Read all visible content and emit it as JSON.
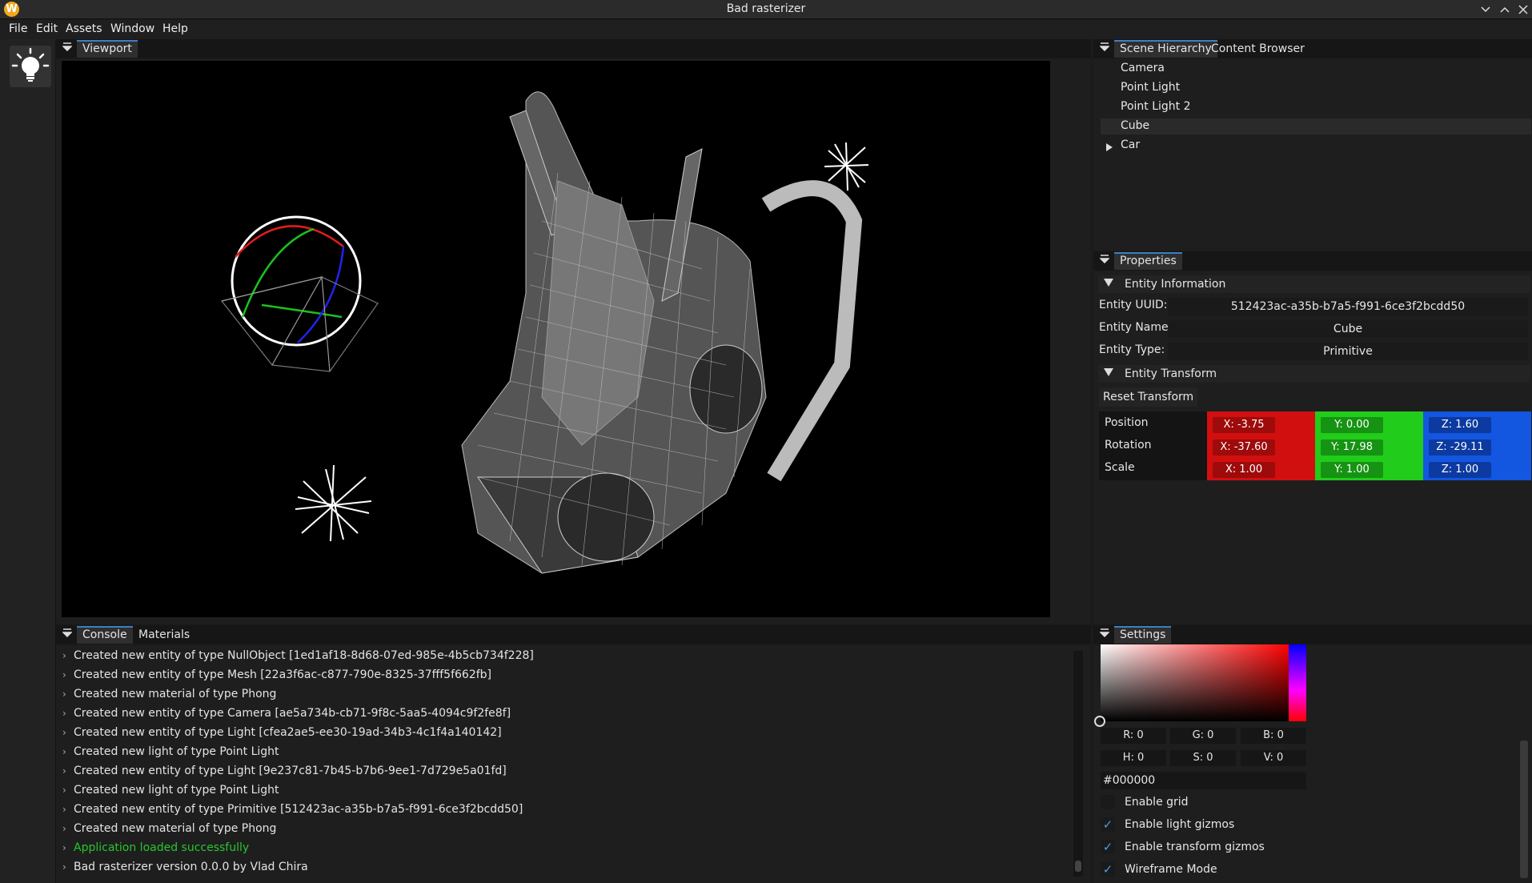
{
  "window": {
    "logo": "W",
    "title": "Bad rasterizer"
  },
  "menu": [
    "File",
    "Edit",
    "Assets",
    "Window",
    "Help"
  ],
  "viewport": {
    "tab": "Viewport"
  },
  "scene": {
    "tabs": [
      "Scene Hierarchy",
      "Content Browser"
    ],
    "items": [
      "Camera",
      "Point Light",
      "Point Light 2",
      "Cube",
      "Car"
    ],
    "selected": "Cube"
  },
  "properties": {
    "tab": "Properties",
    "entity_info": {
      "header": "Entity Information",
      "uuid_label": "Entity UUID:",
      "uuid": "512423ac-a35b-b7a5-f991-6ce3f2bcdd50",
      "name_label": "Entity Name:",
      "name": "Cube",
      "type_label": "Entity Type:",
      "type": "Primitive"
    },
    "transform": {
      "header": "Entity Transform",
      "reset": "Reset Transform",
      "rows": [
        {
          "label": "Position",
          "x": "X: -3.75",
          "y": "Y: 0.00",
          "z": "Z: 1.60"
        },
        {
          "label": "Rotation",
          "x": "X: -37.60",
          "y": "Y: 17.98",
          "z": "Z: -29.11"
        },
        {
          "label": "Scale",
          "x": "X: 1.00",
          "y": "Y: 1.00",
          "z": "Z: 1.00"
        }
      ],
      "colors": {
        "x": "#d20f0f",
        "y": "#21cc1b",
        "z": "#1356e0",
        "x_cell": "#9e0b0b",
        "y_cell": "#169313",
        "z_cell": "#0d3aa1"
      }
    }
  },
  "console": {
    "tabs": [
      "Console",
      "Materials"
    ],
    "lines": [
      "Created new entity of type NullObject  [1ed1af18-8d68-07ed-985e-4b5cb734f228]",
      "Created new entity of type Mesh  [22a3f6ac-c877-790e-8325-37fff5f662fb]",
      "Created new material of type Phong",
      "Created new entity of type Camera  [ae5a734b-cb71-9f8c-5aa5-4094c9f2fe8f]",
      "Created new entity of type Light  [cfea2ae5-ee30-19ad-34b3-4c1f4a140142]",
      "Created new light of type Point Light",
      "Created new entity of type Light  [9e237c81-7b45-b7b6-9ee1-7d729e5a01fd]",
      "Created new light of type Point Light",
      "Created new entity of type Primitive  [512423ac-a35b-b7a5-f991-6ce3f2bcdd50]",
      "Created new material of type Phong",
      "Application loaded successfully",
      "Bad rasterizer version 0.0.0 by Vlad Chira"
    ],
    "success_color": "#27c72b"
  },
  "settings": {
    "tab": "Settings",
    "rgb": {
      "r": "R:  0",
      "g": "G:  0",
      "b": "B:  0"
    },
    "hsv": {
      "h": "H:  0",
      "s": "S:  0",
      "v": "V:  0"
    },
    "hex": "#000000",
    "checks": [
      {
        "label": "Enable grid",
        "checked": false
      },
      {
        "label": "Enable light gizmos",
        "checked": true
      },
      {
        "label": "Enable transform gizmos",
        "checked": true
      },
      {
        "label": "Wireframe Mode",
        "checked": true
      }
    ]
  },
  "icons": {
    "collapse": "triangle-down-icon",
    "tree_expand": "triangle-right-icon",
    "log": "chevron-right-icon",
    "check": "checkmark-icon"
  }
}
